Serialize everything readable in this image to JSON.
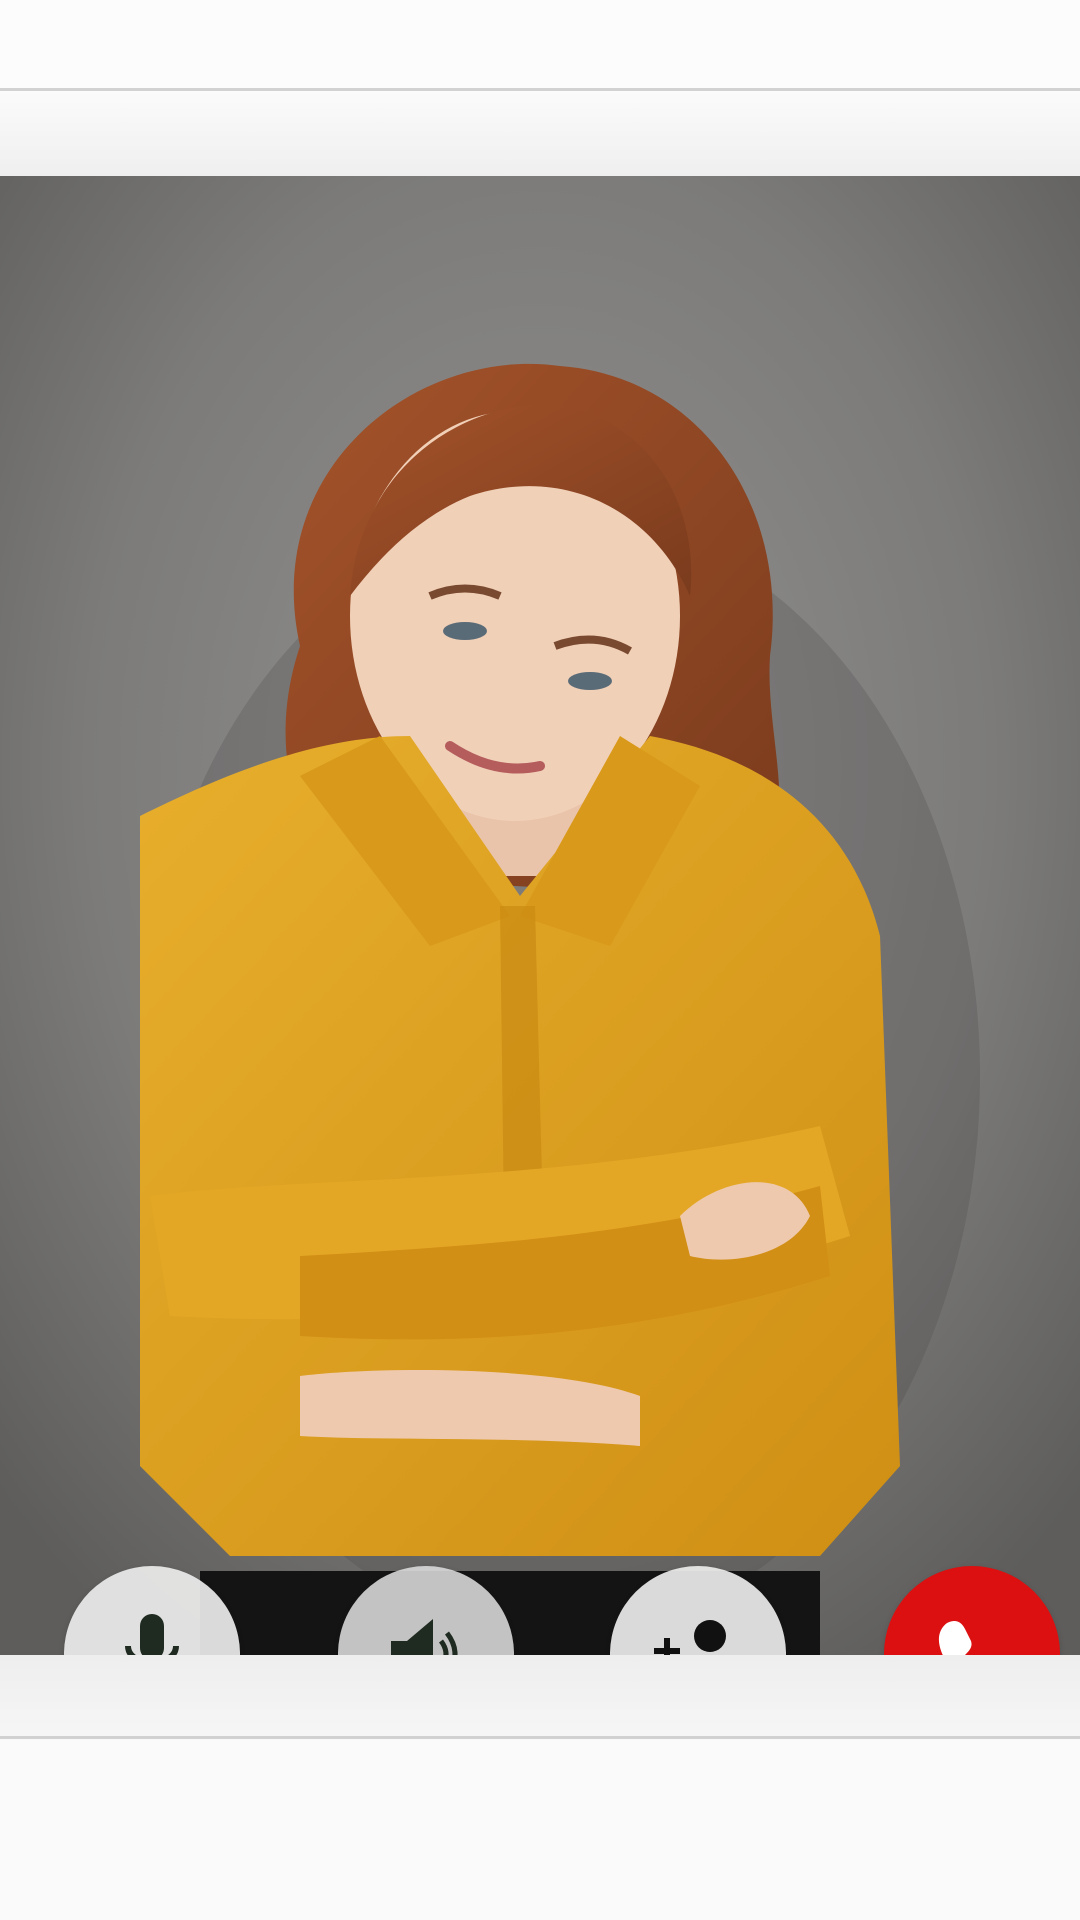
{
  "call": {
    "controls": [
      {
        "id": "mute",
        "icon": "microphone-icon"
      },
      {
        "id": "speaker",
        "icon": "speaker-icon"
      },
      {
        "id": "add-participant",
        "icon": "add-person-icon"
      },
      {
        "id": "end-call",
        "icon": "phone-icon",
        "color": "#dc1010"
      }
    ]
  },
  "colors": {
    "background": "#f7f7f7",
    "divider": "#d2d2d2",
    "control_bg": "#ececec",
    "end_call": "#dc1010"
  }
}
